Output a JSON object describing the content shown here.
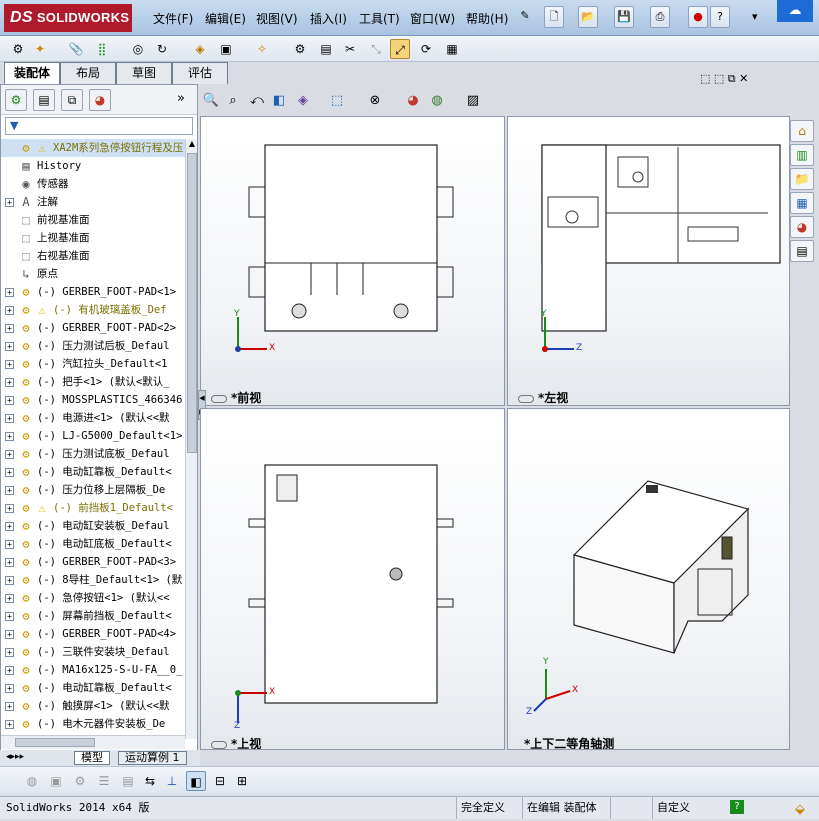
{
  "app": {
    "logo_text": "SOLIDWORKS",
    "menus": [
      "文件(F)",
      "编辑(E)",
      "视图(V)",
      "插入(I)",
      "工具(T)",
      "窗口(W)",
      "帮助(H)"
    ]
  },
  "tabs": [
    "装配体",
    "布局",
    "草图",
    "评估"
  ],
  "feature_tree": {
    "filter_placeholder": "",
    "root": "XA2M系列急停按钮行程及压",
    "items": [
      {
        "label": "History",
        "icon": "history-icon",
        "expand": false,
        "warn": false
      },
      {
        "label": "传感器",
        "icon": "sensor-icon",
        "expand": false,
        "warn": false
      },
      {
        "label": "注解",
        "icon": "annotation-icon",
        "expand": true,
        "warn": false
      },
      {
        "label": "前视基准面",
        "icon": "plane-icon",
        "expand": false,
        "warn": false
      },
      {
        "label": "上视基准面",
        "icon": "plane-icon",
        "expand": false,
        "warn": false
      },
      {
        "label": "右视基准面",
        "icon": "plane-icon",
        "expand": false,
        "warn": false
      },
      {
        "label": "原点",
        "icon": "origin-icon",
        "expand": false,
        "warn": false
      },
      {
        "label": "(-) GERBER_FOOT-PAD<1>",
        "icon": "part-icon",
        "expand": true,
        "warn": false
      },
      {
        "label": "(-) 有机玻璃盖板_Def",
        "icon": "part-icon",
        "expand": true,
        "warn": true
      },
      {
        "label": "(-) GERBER_FOOT-PAD<2>",
        "icon": "part-icon",
        "expand": true,
        "warn": false
      },
      {
        "label": "(-) 压力测试后板_Defaul",
        "icon": "part-icon",
        "expand": true,
        "warn": false
      },
      {
        "label": "(-) 汽缸拉头_Default<1",
        "icon": "part-icon",
        "expand": true,
        "warn": false
      },
      {
        "label": "(-) 把手<1> (默认<默认_",
        "icon": "part-icon",
        "expand": true,
        "warn": false
      },
      {
        "label": "(-) MOSSPLASTICS_466346",
        "icon": "part-icon",
        "expand": true,
        "warn": false
      },
      {
        "label": "(-) 电源进<1> (默认<<默",
        "icon": "part-icon",
        "expand": true,
        "warn": false
      },
      {
        "label": "(-) LJ-G5000_Default<1>",
        "icon": "part-icon",
        "expand": true,
        "warn": false
      },
      {
        "label": "(-) 压力测试底板_Defaul",
        "icon": "part-icon",
        "expand": true,
        "warn": false
      },
      {
        "label": "(-) 电动缸靠板_Default<",
        "icon": "part-icon",
        "expand": true,
        "warn": false
      },
      {
        "label": "(-) 压力位移上层隔板_De",
        "icon": "part-icon",
        "expand": true,
        "warn": false
      },
      {
        "label": "(-) 前挡板1_Default<",
        "icon": "part-icon",
        "expand": true,
        "warn": true
      },
      {
        "label": "(-) 电动缸安装板_Defaul",
        "icon": "part-icon",
        "expand": true,
        "warn": false
      },
      {
        "label": "(-) 电动缸底板_Default<",
        "icon": "part-icon",
        "expand": true,
        "warn": false
      },
      {
        "label": "(-) GERBER_FOOT-PAD<3>",
        "icon": "part-icon",
        "expand": true,
        "warn": false
      },
      {
        "label": "(-) 8导柱_Default<1> (默",
        "icon": "part-icon",
        "expand": true,
        "warn": false
      },
      {
        "label": "(-) 急停按钮<1> (默认<<",
        "icon": "part-icon",
        "expand": true,
        "warn": false
      },
      {
        "label": "(-) 屏幕前挡板_Default<",
        "icon": "part-icon",
        "expand": true,
        "warn": false
      },
      {
        "label": "(-) GERBER_FOOT-PAD<4>",
        "icon": "part-icon",
        "expand": true,
        "warn": false
      },
      {
        "label": "(-) 三联件安装块_Defaul",
        "icon": "part-icon",
        "expand": true,
        "warn": false
      },
      {
        "label": "(-) MA16x125-S-U-FA__0_",
        "icon": "part-icon",
        "expand": true,
        "warn": false
      },
      {
        "label": "(-) 电动缸靠板_Default<",
        "icon": "part-icon",
        "expand": true,
        "warn": false
      },
      {
        "label": "(-) 触摸屏<1> (默认<<默",
        "icon": "part-icon",
        "expand": true,
        "warn": false
      },
      {
        "label": "(-) 电木元器件安装板_De",
        "icon": "part-icon",
        "expand": true,
        "warn": false
      }
    ]
  },
  "viewports": {
    "front": "*前视",
    "left": "*左视",
    "top": "*上视",
    "iso": "*上下二等角轴测"
  },
  "axes": {
    "x": "X",
    "y": "Y",
    "z": "Z"
  },
  "bottom_tabs": [
    "模型",
    "运动算例 1"
  ],
  "status": {
    "version": "SolidWorks 2014 x64 版",
    "definition": "完全定义",
    "editing": "在编辑 装配体",
    "custom": "自定义",
    "help": "?"
  },
  "colors": {
    "accent": "#b0192c",
    "selection": "#cfe0f5",
    "warning": "#e6c200"
  }
}
